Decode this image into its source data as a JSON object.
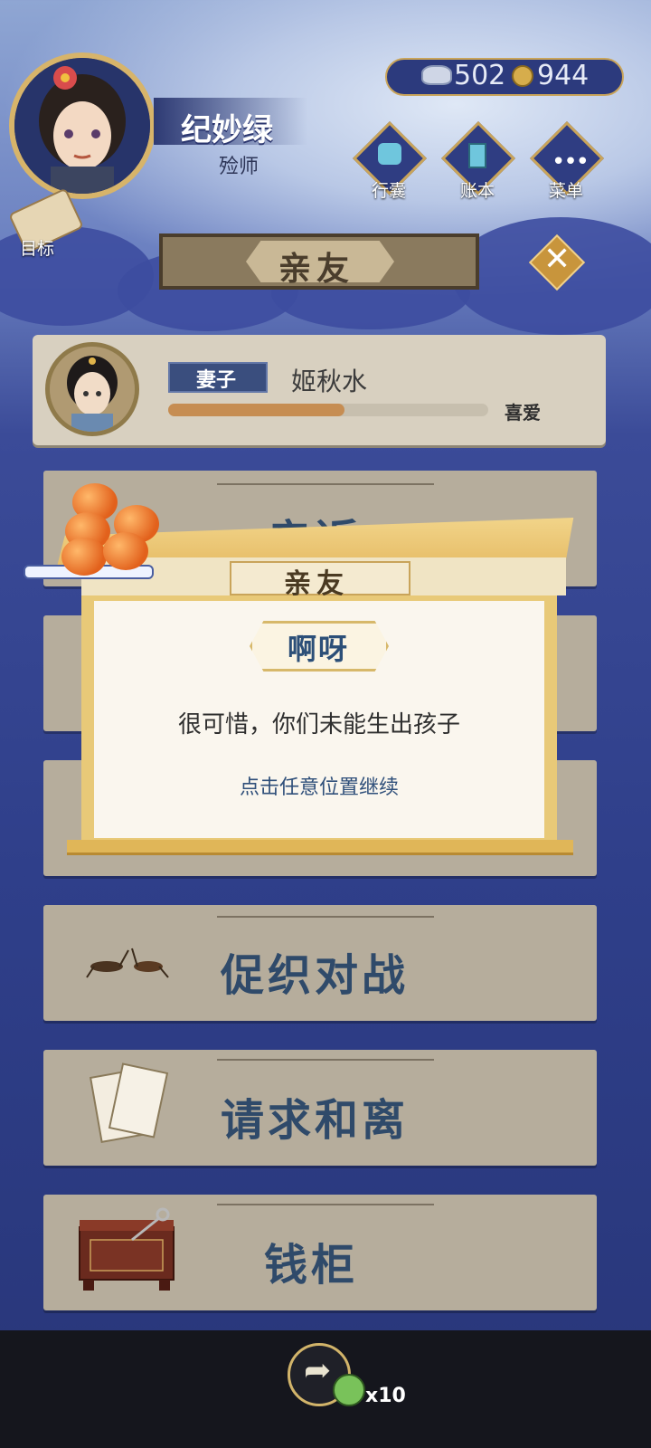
{
  "player": {
    "name": "纪妙绿",
    "title": "殓师"
  },
  "currency": {
    "silver": "502",
    "coins": "944"
  },
  "menu": {
    "bag_label": "行囊",
    "ledger_label": "账本",
    "menu_label": "菜单"
  },
  "target_label": "目标",
  "header": {
    "title": "亲友"
  },
  "relation": {
    "role": "妻子",
    "name": "姬秋水",
    "mood": "喜爱",
    "affection_fraction": 0.55
  },
  "options": [
    {
      "label": "亲近"
    },
    {
      "label": ""
    },
    {
      "label": ""
    },
    {
      "label": "促织对战"
    },
    {
      "label": "请求和离"
    },
    {
      "label": "钱柜"
    }
  ],
  "dialog": {
    "banner": "亲友",
    "title": "啊呀",
    "message": "很可惜，你们未能生出孩子",
    "hint": "点击任意位置继续"
  },
  "bottom": {
    "share_count": "x10"
  },
  "colors": {
    "accent_gold": "#c9a45a",
    "navy": "#2f3f8a",
    "card": "#b6ad9c",
    "text_blue": "#2f4a6a"
  }
}
